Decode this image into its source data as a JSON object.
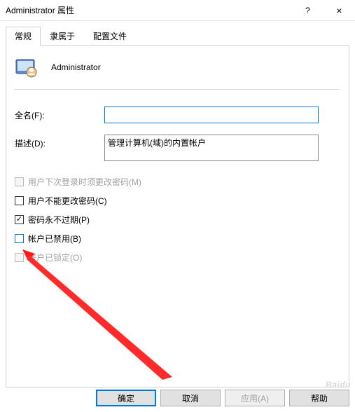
{
  "window": {
    "title": "Administrator 属性",
    "help_symbol": "?",
    "close_symbol": "×"
  },
  "tabs": {
    "items": [
      {
        "label": "常规"
      },
      {
        "label": "隶属于"
      },
      {
        "label": "配置文件"
      }
    ]
  },
  "header": {
    "name": "Administrator"
  },
  "fields": {
    "fullname_label": "全名(F):",
    "fullname_value": "",
    "description_label": "描述(D):",
    "description_value": "管理计算机(域)的内置帐户"
  },
  "checks": {
    "must_change": "用户下次登录时须更改密码(M)",
    "cannot_change": "用户不能更改密码(C)",
    "never_expire": "密码永不过期(P)",
    "disabled": "帐户已禁用(B)",
    "locked": "帐户已锁定(O)"
  },
  "buttons": {
    "ok": "确定",
    "cancel": "取消",
    "apply": "应用(A)",
    "help": "帮助"
  },
  "watermark": "Baidu"
}
